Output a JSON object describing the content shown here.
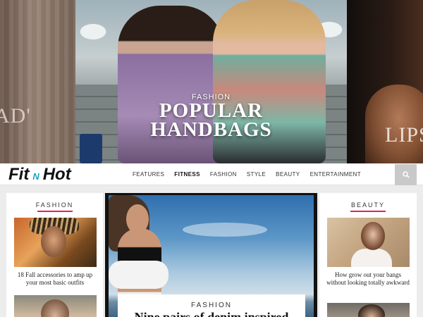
{
  "hero": {
    "left_slide_text": "AD'",
    "right_slide_text": "LIPS",
    "main_kicker": "FASHION",
    "main_title_line1": "POPULAR",
    "main_title_line2": "HANDBAGS"
  },
  "navbar": {
    "logo_part1": "Fit",
    "logo_part2": "N",
    "logo_part3": "Hot",
    "items": [
      {
        "label": "FEATURES",
        "active": false
      },
      {
        "label": "FITNESS",
        "active": true
      },
      {
        "label": "FASHION",
        "active": false
      },
      {
        "label": "STYLE",
        "active": false
      },
      {
        "label": "BEAUTY",
        "active": false
      },
      {
        "label": "ENTERTAINMENT",
        "active": false
      }
    ],
    "search_icon": "search-icon"
  },
  "left_column": {
    "title": "FASHION",
    "posts": [
      {
        "title": "18 Fall accessories to amp up your most basic outfits"
      }
    ]
  },
  "feature": {
    "kicker": "FASHION",
    "headline": "Nine pairs of denim inspired"
  },
  "right_column": {
    "title": "BEAUTY",
    "posts": [
      {
        "title": "How grow out your bangs without looking totally awkward"
      }
    ]
  },
  "colors": {
    "accent": "#e0245e",
    "logo_accent": "#1aa3c8",
    "search_bg": "#c9c9c9"
  }
}
